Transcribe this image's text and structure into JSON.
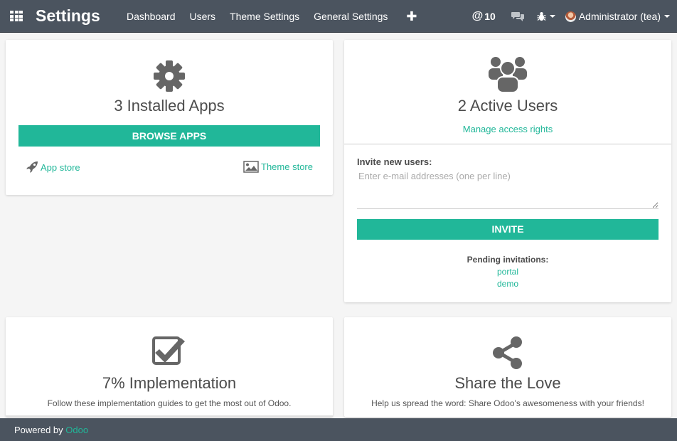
{
  "navbar": {
    "brand": "Settings",
    "menu": [
      "Dashboard",
      "Users",
      "Theme Settings",
      "General Settings"
    ],
    "plus_label": "✚",
    "mentions_symbol": "@",
    "mentions_count": "10",
    "user_label": "Administrator (tea)"
  },
  "apps_card": {
    "title": "3 Installed Apps",
    "browse_button": "BROWSE APPS",
    "app_store_link": "App store",
    "theme_store_link": "Theme store"
  },
  "users_card": {
    "title": "2 Active Users",
    "manage_link": "Manage access rights",
    "invite_label": "Invite new users:",
    "invite_placeholder": "Enter e-mail addresses (one per line)",
    "invite_button": "INVITE",
    "pending_title": "Pending invitations:",
    "pending": [
      "portal",
      "demo"
    ]
  },
  "implementation_card": {
    "title": "7% Implementation",
    "subtitle": "Follow these implementation guides to get the most out of Odoo."
  },
  "share_card": {
    "title": "Share the Love",
    "subtitle": "Help us spread the word: Share Odoo's awesomeness with your friends!"
  },
  "footer": {
    "prefix": "Powered by",
    "link": "Odoo"
  },
  "colors": {
    "navbar": "#4b545f",
    "accent": "#21b799",
    "background": "#f5f5f5"
  },
  "icons": [
    "apps-grid-icon",
    "chat-icon",
    "bug-icon",
    "gear-icon",
    "rocket-icon",
    "image-icon",
    "users-icon",
    "checkbox-icon",
    "share-icon"
  ]
}
